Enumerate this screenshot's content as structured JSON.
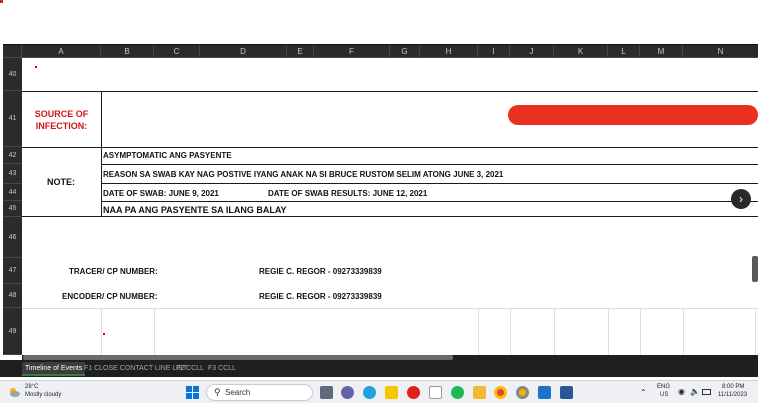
{
  "spreadsheet": {
    "columns": [
      "A",
      "B",
      "C",
      "D",
      "E",
      "F",
      "G",
      "H",
      "I",
      "J",
      "K",
      "L",
      "M",
      "N"
    ],
    "rows": [
      "40",
      "41",
      "42",
      "43",
      "44",
      "45",
      "46",
      "47",
      "48",
      "49"
    ],
    "source_label": "SOURCE OF INFECTION:",
    "note_label": "NOTE:",
    "note_lines": [
      "ASYMPTOMATIC ANG PASYENTE",
      "REASON SA SWAB KAY NAG POSTIVE IYANG ANAK NA SI BRUCE RUSTOM SELIM ATONG JUNE 3, 2021",
      "DATE OF SWAB: JUNE 9, 2021",
      "NAA PA ANG PASYENTE SA ILANG BALAY"
    ],
    "swab_results": "DATE OF SWAB RESULTS: JUNE 12, 2021",
    "tracer_label": "TRACER/ CP NUMBER:",
    "tracer_value": "REGIE C. REGOR - 09273339839",
    "encoder_label": "ENCODER/ CP NUMBER:",
    "encoder_value": "REGIE C. REGOR - 09273339839",
    "nav_arrow": "›"
  },
  "sheet_tabs": [
    {
      "label": "Timeline of Events",
      "active": true
    },
    {
      "label": "F1 CLOSE CONTACT LINE LIST",
      "active": false
    },
    {
      "label": "F2 CCLL",
      "active": false
    },
    {
      "label": "F3 CCLL",
      "active": false
    }
  ],
  "taskbar": {
    "weather_temp": "28°C",
    "weather_desc": "Mostly cloudy",
    "search_label": "Search",
    "language": "ENG",
    "region": "US",
    "time": "8:00 PM",
    "date": "11/11/2023",
    "icons": [
      "start-icon",
      "search-icon",
      "file-explorer-icon",
      "meet-icon",
      "edge-icon",
      "sticky-notes-icon",
      "opera-icon",
      "document-icon",
      "spotify-icon",
      "folder-icon",
      "chrome-icon",
      "chrome-canary-icon",
      "edit-icon",
      "word-icon"
    ]
  },
  "colors": {
    "redaction": "#e8321f",
    "label_red": "#d21414",
    "dark_header": "#2b2b2b"
  }
}
